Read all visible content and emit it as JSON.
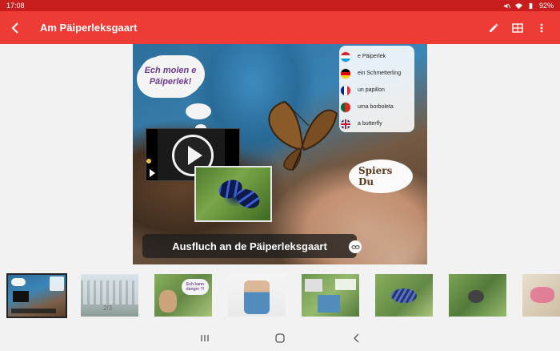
{
  "status_bar": {
    "time": "17:08",
    "battery": "92%"
  },
  "app_bar": {
    "title": "Am Päiperleksgaart"
  },
  "slide": {
    "cloud_text": "Ech molen e Päiperlek!",
    "flags": [
      {
        "label": "e Päiperlek",
        "country": "lu"
      },
      {
        "label": "ein Schmetterling",
        "country": "de"
      },
      {
        "label": "un papillon",
        "country": "fr"
      },
      {
        "label": "uma borboleta",
        "country": "pt"
      },
      {
        "label": "a butterfly",
        "country": "gb"
      }
    ],
    "speech_line1": "Spiers",
    "speech_line2": "Du",
    "caption": "Ausfluch an de Päiperleksgaart"
  },
  "thumbnails": {
    "page_indicator": "2/3",
    "second_thumb_caption": "Ech kann danger ?!"
  },
  "colors": {
    "status_bar": "#c81d1d",
    "app_bar": "#ef3b36",
    "background": "#f2f2f2"
  }
}
